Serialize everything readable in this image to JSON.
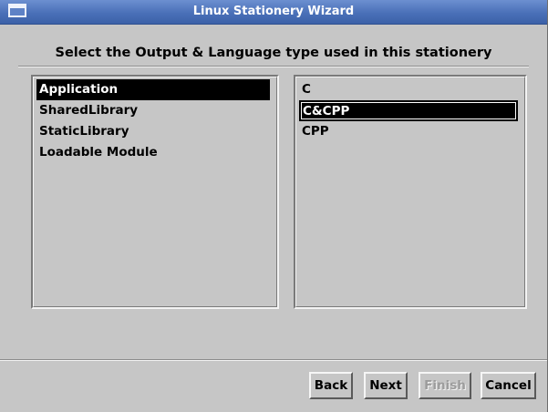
{
  "window": {
    "title": "Linux Stationery Wizard",
    "icon": "window-icon"
  },
  "instruction": "Select the Output & Language type used in this stationery",
  "output_list": {
    "items": [
      {
        "label": "Application",
        "selected": true
      },
      {
        "label": "SharedLibrary",
        "selected": false
      },
      {
        "label": "StaticLibrary",
        "selected": false
      },
      {
        "label": "Loadable Module",
        "selected": false
      }
    ]
  },
  "language_list": {
    "items": [
      {
        "label": "C",
        "selected": false
      },
      {
        "label": "C&CPP",
        "selected": true
      },
      {
        "label": "CPP",
        "selected": false
      }
    ]
  },
  "buttons": {
    "back": {
      "label": "Back",
      "enabled": true
    },
    "next": {
      "label": "Next",
      "enabled": true
    },
    "finish": {
      "label": "Finish",
      "enabled": false
    },
    "cancel": {
      "label": "Cancel",
      "enabled": true
    }
  },
  "colors": {
    "titlebar": "#4a70b8",
    "window_bg": "#c6c6c6",
    "selection_bg": "#000000",
    "selection_fg": "#ffffff"
  }
}
